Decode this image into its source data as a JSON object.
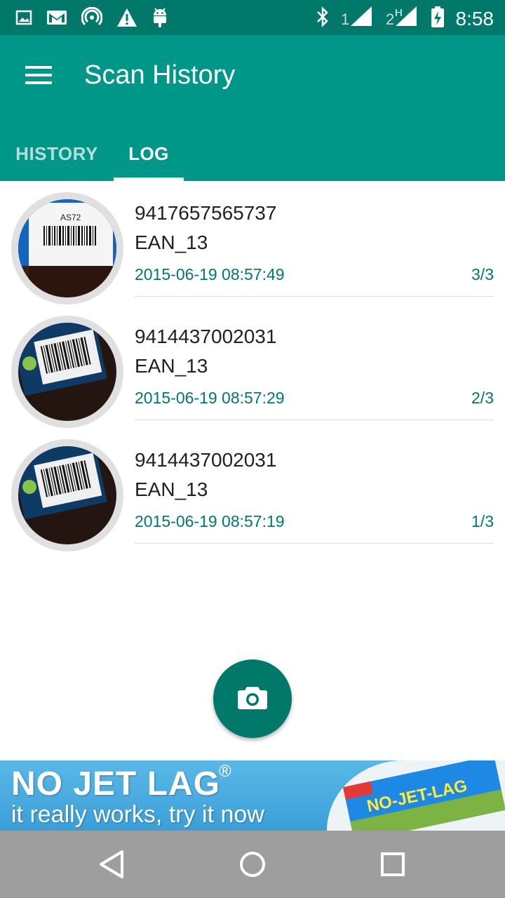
{
  "status_bar": {
    "time": "8:58",
    "icons": [
      "image-icon",
      "gmail-icon",
      "hotspot-icon",
      "warning-icon",
      "android-icon",
      "bluetooth-icon",
      "signal-1-icon",
      "signal-2-icon",
      "battery-charging-icon"
    ],
    "sim1_label": "1",
    "sim2_label": "2",
    "sim2_network": "H"
  },
  "app_bar": {
    "title": "Scan History",
    "menu_icon": "hamburger-menu-icon",
    "background": "#009688"
  },
  "tabs": [
    {
      "label": "HISTORY",
      "selected": false
    },
    {
      "label": "LOG",
      "selected": true
    }
  ],
  "scans": [
    {
      "code": "9417657565737",
      "format": "EAN_13",
      "timestamp": "2015-06-19 08:57:49",
      "count": "3/3"
    },
    {
      "code": "9414437002031",
      "format": "EAN_13",
      "timestamp": "2015-06-19 08:57:29",
      "count": "2/3"
    },
    {
      "code": "9414437002031",
      "format": "EAN_13",
      "timestamp": "2015-06-19 08:57:19",
      "count": "1/3"
    }
  ],
  "fab": {
    "icon": "camera-icon",
    "color": "#00796b"
  },
  "ad": {
    "headline": "NO JET LAG",
    "registered": "®",
    "tagline": "it really works, try it now",
    "product_label": "NO-JET-LAG"
  },
  "nav_bar": {
    "icons": [
      "back-icon",
      "home-icon",
      "recents-icon"
    ]
  },
  "colors": {
    "primary": "#009688",
    "primary_dark": "#00796b",
    "accent_text": "#00796b"
  }
}
